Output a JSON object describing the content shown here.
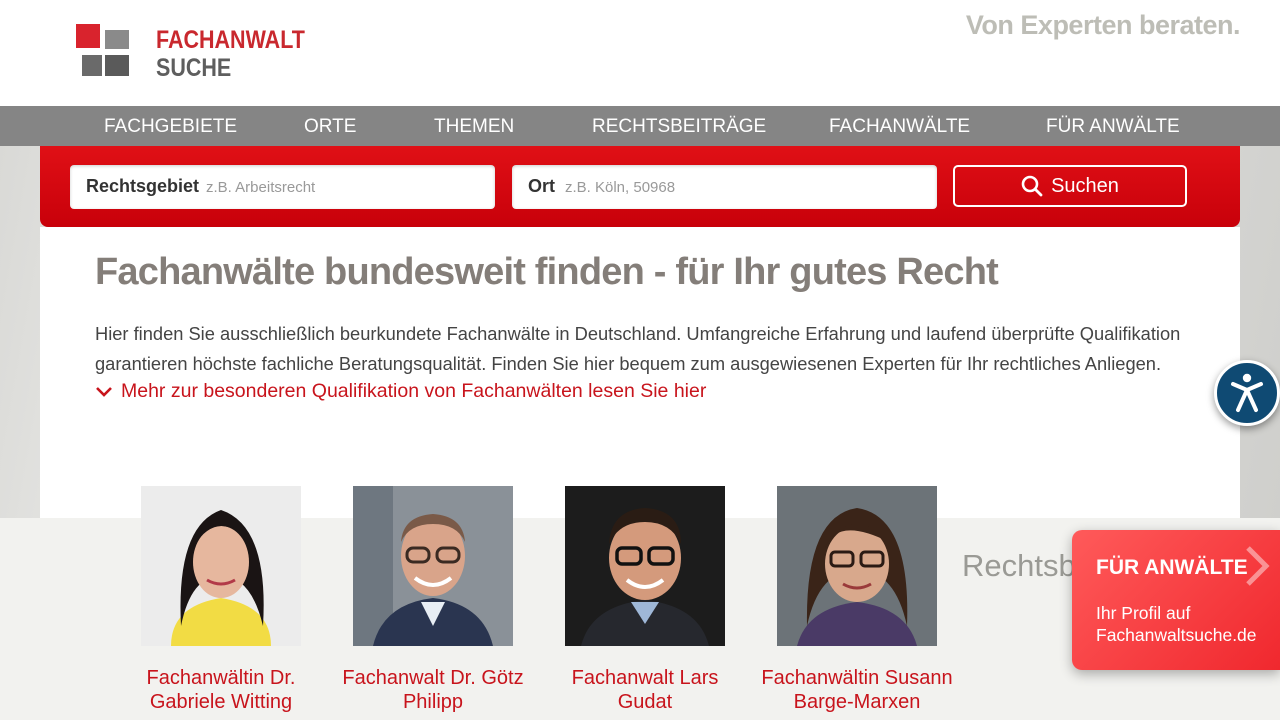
{
  "header": {
    "logo_line1": "FACHANWALT",
    "logo_line2": "SUCHE",
    "slogan": "Von Experten beraten."
  },
  "nav": {
    "items": [
      {
        "label": "FACHGEBIETE"
      },
      {
        "label": "ORTE"
      },
      {
        "label": "THEMEN"
      },
      {
        "label": "RECHTSBEITRÄGE"
      },
      {
        "label": "FACHANWÄLTE"
      },
      {
        "label": "FÜR ANWÄLTE"
      }
    ]
  },
  "search": {
    "area_label": "Rechtsgebiet",
    "area_placeholder": "z.B. Arbeitsrecht",
    "location_label": "Ort",
    "location_placeholder": "z.B. Köln, 50968",
    "button_label": "Suchen"
  },
  "main": {
    "title": "Fachanwälte bundesweit finden - für Ihr gutes Recht",
    "intro": "Hier finden Sie ausschließlich beurkundete Fachanwälte in Deutschland. Umfangreiche Erfahrung und laufend überprüfte Qualifikation garantieren höchste fachliche Beratungsqualität. Finden Sie hier bequem zum ausgewiesenen Experten für Ihr rechtliches Anliegen.",
    "more_link": "Mehr zur besonderen Qualifikation von Fachanwälten lesen Sie hier"
  },
  "lawyers": [
    {
      "name": "Fachanwältin Dr. Gabriele Witting"
    },
    {
      "name": "Fachanwalt Dr. Götz Philipp"
    },
    {
      "name": "Fachanwalt Lars Gudat"
    },
    {
      "name": "Fachanwältin Susann Barge-Marxen"
    }
  ],
  "section_heading_partial": "Rechtsbe",
  "promo": {
    "title": "FÜR ANWÄLTE",
    "subtitle": "Ihr Profil auf Fachanwaltsuche.de"
  },
  "colors": {
    "brand_red": "#c8141c",
    "nav_gray": "#858585",
    "a11y_blue": "#0f4a73"
  }
}
